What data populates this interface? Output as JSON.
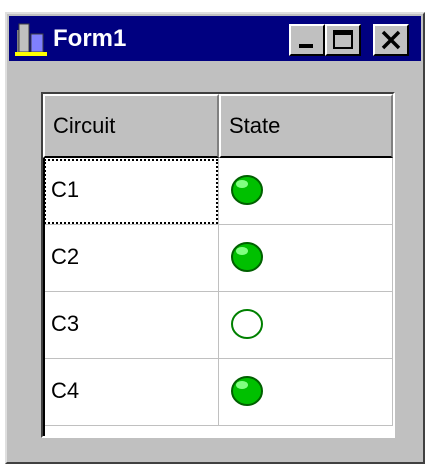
{
  "window": {
    "title": "Form1"
  },
  "grid": {
    "columns": [
      "Circuit",
      "State"
    ],
    "rows": [
      {
        "circuit": "C1",
        "state": "on"
      },
      {
        "circuit": "C2",
        "state": "on"
      },
      {
        "circuit": "C3",
        "state": "off"
      },
      {
        "circuit": "C4",
        "state": "on"
      }
    ]
  },
  "colors": {
    "titlebar": "#000080",
    "lamp_on": "#00c000",
    "lamp_off": "#ffffff"
  },
  "icons": {
    "app": "app-icon",
    "minimize": "minimize-icon",
    "maximize": "maximize-icon",
    "close": "close-icon"
  }
}
